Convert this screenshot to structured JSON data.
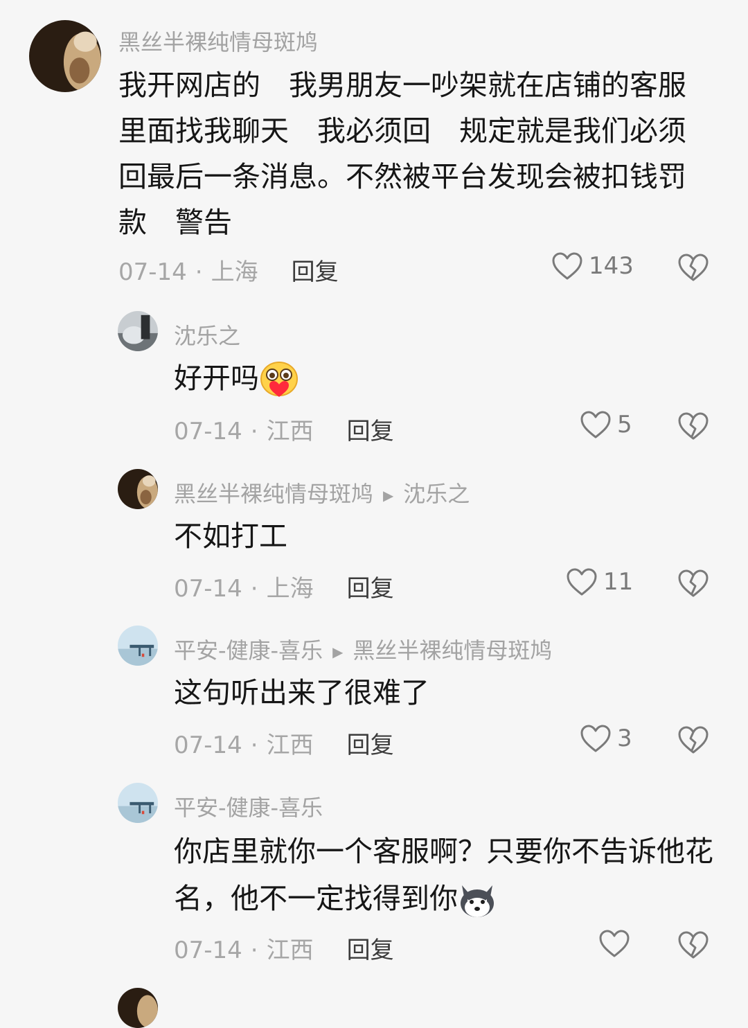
{
  "comments": [
    {
      "author": "黑丝半裸纯情母斑鸠",
      "text": "我开网店的　我男朋友一吵架就在店铺的客服里面找我聊天　我必须回　规定就是我们必须回最后一条消息。不然被平台发现会被扣钱罚款　警告",
      "date": "07-14",
      "location": "上海",
      "reply": "回复",
      "likes": "143"
    },
    {
      "author": "沈乐之",
      "text": "好开吗",
      "emoji": "heart-eyes-emoji",
      "date": "07-14",
      "location": "江西",
      "reply": "回复",
      "likes": "5"
    },
    {
      "author": "黑丝半裸纯情母斑鸠",
      "reply_to": "沈乐之",
      "text": "不如打工",
      "date": "07-14",
      "location": "上海",
      "reply": "回复",
      "likes": "11"
    },
    {
      "author": "平安-健康-喜乐",
      "reply_to": "黑丝半裸纯情母斑鸠",
      "text": "这句听出来了很难了",
      "date": "07-14",
      "location": "江西",
      "reply": "回复",
      "likes": "3"
    },
    {
      "author": "平安-健康-喜乐",
      "text": "你店里就你一个客服啊？只要你不告诉他花名，他不一定找得到你",
      "emoji": "husky-dog-emoji",
      "date": "07-14",
      "location": "江西",
      "reply": "回复",
      "likes": ""
    }
  ],
  "colors": {
    "background": "#f6f6f6",
    "author": "#a3a3a3",
    "text": "#161616",
    "meta": "#a6a6a6"
  }
}
